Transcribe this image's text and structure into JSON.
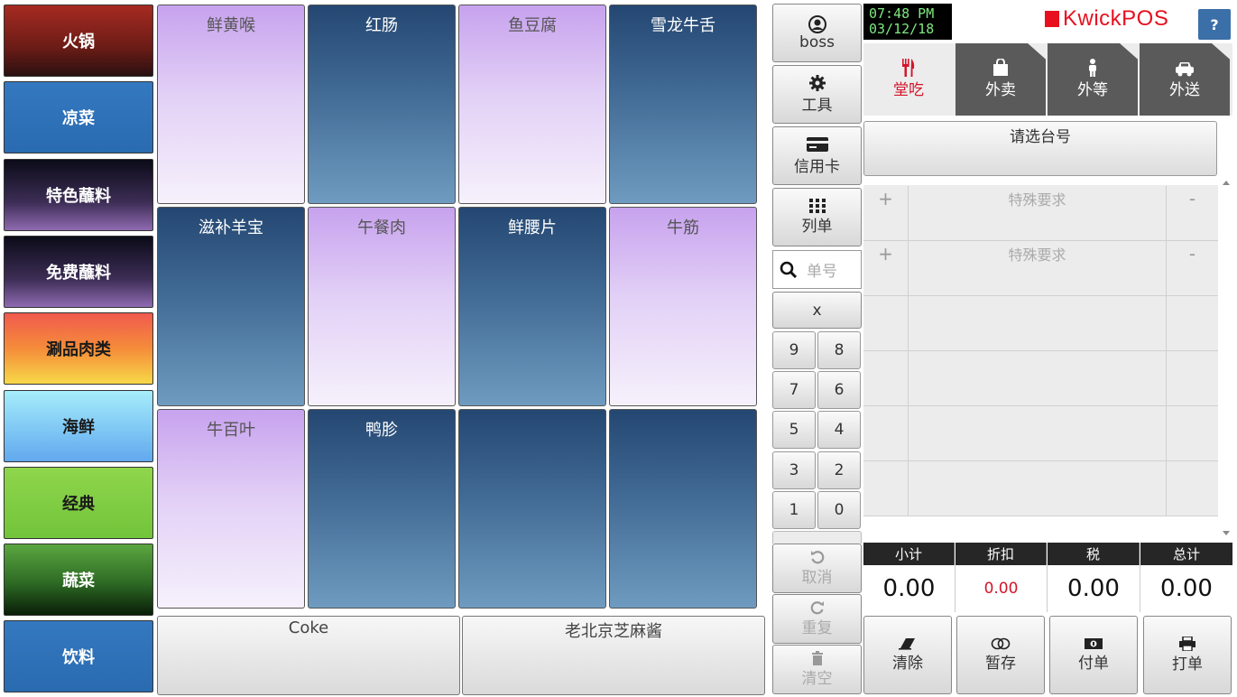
{
  "categories": [
    {
      "label": "火锅"
    },
    {
      "label": "凉菜"
    },
    {
      "label": "特色蘸料"
    },
    {
      "label": "免费蘸料"
    },
    {
      "label": "涮品肉类"
    },
    {
      "label": "海鲜"
    },
    {
      "label": "经典"
    },
    {
      "label": "蔬菜"
    },
    {
      "label": "饮料"
    }
  ],
  "items": [
    {
      "label": "鲜黄喉"
    },
    {
      "label": "红肠"
    },
    {
      "label": "鱼豆腐"
    },
    {
      "label": "雪龙牛舌"
    },
    {
      "label": "滋补羊宝"
    },
    {
      "label": "午餐肉"
    },
    {
      "label": "鲜腰片"
    },
    {
      "label": "牛筋"
    },
    {
      "label": "牛百叶"
    },
    {
      "label": "鸭胗"
    },
    {
      "label": ""
    },
    {
      "label": ""
    }
  ],
  "bottom_items": [
    {
      "label": "Coke"
    },
    {
      "label": "老北京芝麻酱"
    }
  ],
  "tools": {
    "user": "boss",
    "tools_label": "工具",
    "credit_card": "信用卡",
    "list": "列单",
    "search_placeholder": "单号",
    "clear_x": "x",
    "keypad": [
      "9",
      "8",
      "7",
      "6",
      "5",
      "4",
      "3",
      "2",
      "1",
      "0"
    ],
    "cancel": "取消",
    "repeat": "重复",
    "empty": "清空"
  },
  "header": {
    "time": "07:48 PM",
    "date": "03/12/18",
    "brand": "KwickPOS",
    "help": "?"
  },
  "order_tabs": [
    {
      "label": "堂吃",
      "icon": "fork-knife-icon"
    },
    {
      "label": "外卖",
      "icon": "shopping-bag-icon"
    },
    {
      "label": "外等",
      "icon": "person-icon"
    },
    {
      "label": "外送",
      "icon": "car-icon"
    }
  ],
  "table_select": "请选台号",
  "order_rows": [
    {
      "plus": "+",
      "request": "特殊要求",
      "minus": "-"
    },
    {
      "plus": "+",
      "request": "特殊要求",
      "minus": "-"
    }
  ],
  "totals": {
    "headers": [
      "小计",
      "折扣",
      "税",
      "总计"
    ],
    "subtotal": "0.00",
    "discount": "0.00",
    "tax": "0.00",
    "total": "0.00"
  },
  "actions": [
    {
      "label": "清除"
    },
    {
      "label": "暂存"
    },
    {
      "label": "付单"
    },
    {
      "label": "打单"
    }
  ],
  "colors": {
    "brand_red": "#e8101f",
    "active_tab_text": "#d4152a",
    "clock_text": "#7fe87f",
    "discount_red": "#d4152a"
  }
}
